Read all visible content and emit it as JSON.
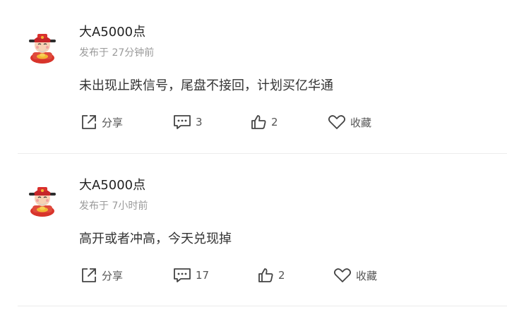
{
  "posts": [
    {
      "username": "大A5000点",
      "time": "发布于 27分钟前",
      "content": "未出现止跌信号，尾盘不接回，计划买亿华通",
      "share_label": "分享",
      "comments": "3",
      "likes": "2",
      "favorite_label": "收藏"
    },
    {
      "username": "大A5000点",
      "time": "发布于 7小时前",
      "content": "高开或者冲高，今天兑现掉",
      "share_label": "分享",
      "comments": "17",
      "likes": "2",
      "favorite_label": "收藏"
    }
  ],
  "icons": {
    "share": "share-icon",
    "comment": "comment-icon",
    "like": "thumbs-up-icon",
    "favorite": "heart-icon",
    "avatar": "god-of-wealth-avatar"
  },
  "colors": {
    "text_primary": "#222222",
    "text_secondary": "#9a9a9a",
    "icon_stroke": "#444444"
  }
}
